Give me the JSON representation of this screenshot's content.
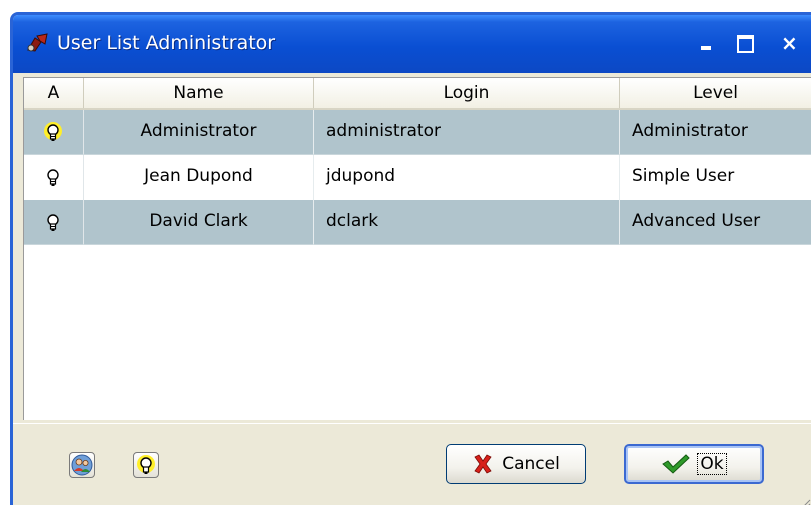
{
  "window": {
    "title": "User List Administrator",
    "title_icon": "admin-app-icon",
    "controls": {
      "minimize": "minimize-icon",
      "maximize": "maximize-icon",
      "close": "×"
    }
  },
  "table": {
    "columns": [
      "A",
      "Name",
      "Login",
      "Level"
    ],
    "rows": [
      {
        "active": true,
        "name": "Administrator",
        "login": "administrator",
        "level": "Administrator"
      },
      {
        "active": false,
        "name": "Jean Dupond",
        "login": "jdupond",
        "level": "Simple User"
      },
      {
        "active": false,
        "name": "David Clark",
        "login": "dclark",
        "level": "Advanced User"
      }
    ]
  },
  "footer": {
    "users_icon": "users-icon",
    "activate_icon": "lightbulb-icon",
    "cancel_label": "Cancel",
    "ok_label": "Ok"
  },
  "colors": {
    "titlebar": "#0a4fd3",
    "row_highlight": "#b0c4cc",
    "bulb_active": "#ffef2a"
  }
}
